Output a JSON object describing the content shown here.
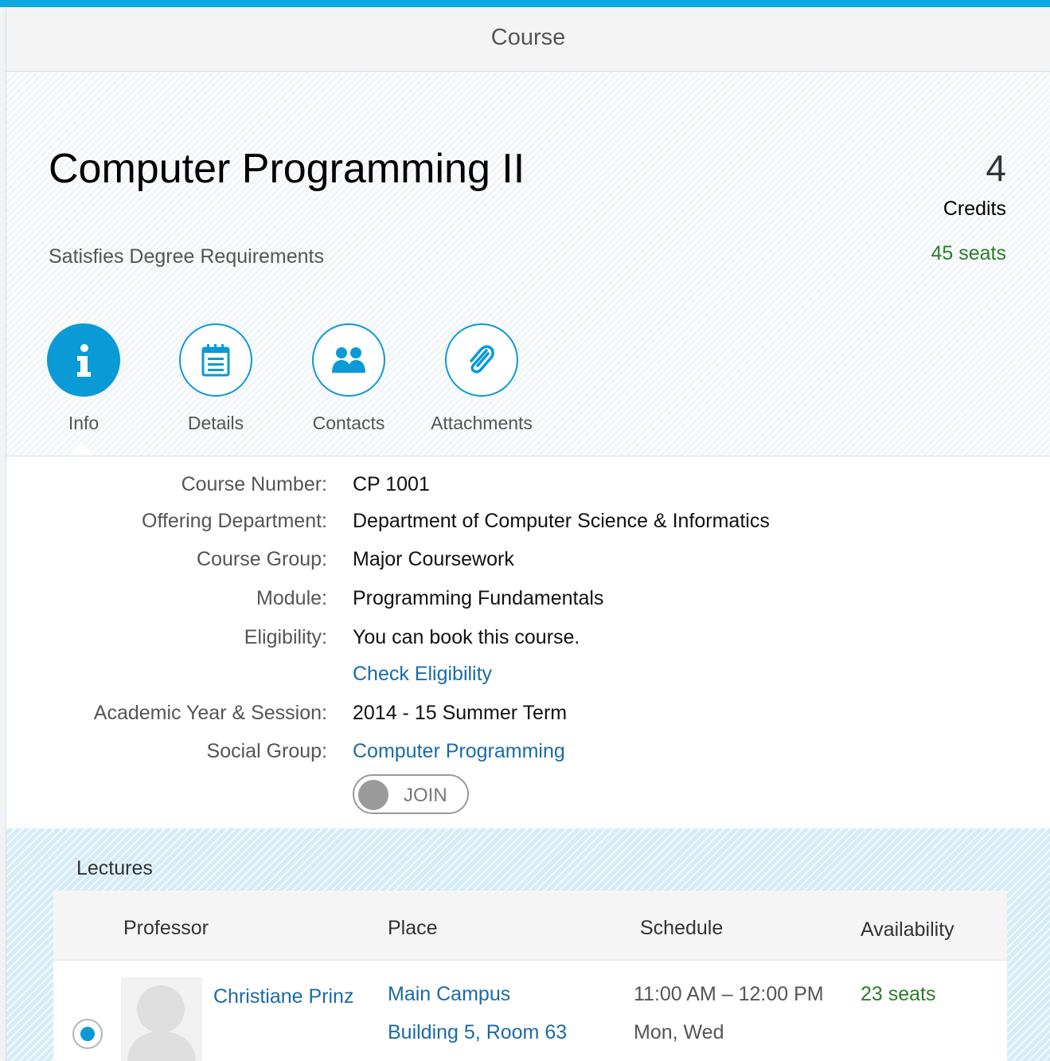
{
  "header": {
    "title": "Course"
  },
  "course": {
    "title": "Computer Programming II",
    "credits_value": "4",
    "credits_label": "Credits",
    "seats": "45 seats",
    "subtitle": "Satisfies Degree Requirements"
  },
  "tabs": [
    {
      "label": "Info",
      "icon": "info-icon",
      "active": true
    },
    {
      "label": "Details",
      "icon": "calendar-list-icon",
      "active": false
    },
    {
      "label": "Contacts",
      "icon": "group-icon",
      "active": false
    },
    {
      "label": "Attachments",
      "icon": "paperclip-icon",
      "active": false
    }
  ],
  "info": {
    "course_number": {
      "label": "Course Number:",
      "value": "CP 1001"
    },
    "department": {
      "label": "Offering Department:",
      "value": "Department of Computer Science & Informatics"
    },
    "course_group": {
      "label": "Course Group:",
      "value": "Major Coursework"
    },
    "module": {
      "label": "Module:",
      "value": "Programming Fundamentals"
    },
    "eligibility": {
      "label": "Eligibility:",
      "value": "You can book this course.",
      "link": "Check Eligibility"
    },
    "academic_year": {
      "label": "Academic Year & Session:",
      "value": "2014 - 15 Summer Term"
    },
    "social_group": {
      "label": "Social Group:",
      "value": "Computer Programming",
      "toggle_label": "JOIN",
      "toggle_on": false
    }
  },
  "lectures": {
    "title": "Lectures",
    "columns": [
      "Professor",
      "Place",
      "Schedule",
      "Availability"
    ],
    "rows": [
      {
        "selected": true,
        "professor": "Christiane Prinz",
        "place_line1": "Main Campus",
        "place_line2": "Building 5, Room 63",
        "time": "11:00 AM – 12:00 PM",
        "days": "Mon, Wed",
        "availability": "23 seats"
      }
    ]
  },
  "colors": {
    "accent": "#0a9ad6",
    "top_bar": "#0aa9e1",
    "link": "#1a6ba8",
    "positive": "#2b7d2b"
  }
}
